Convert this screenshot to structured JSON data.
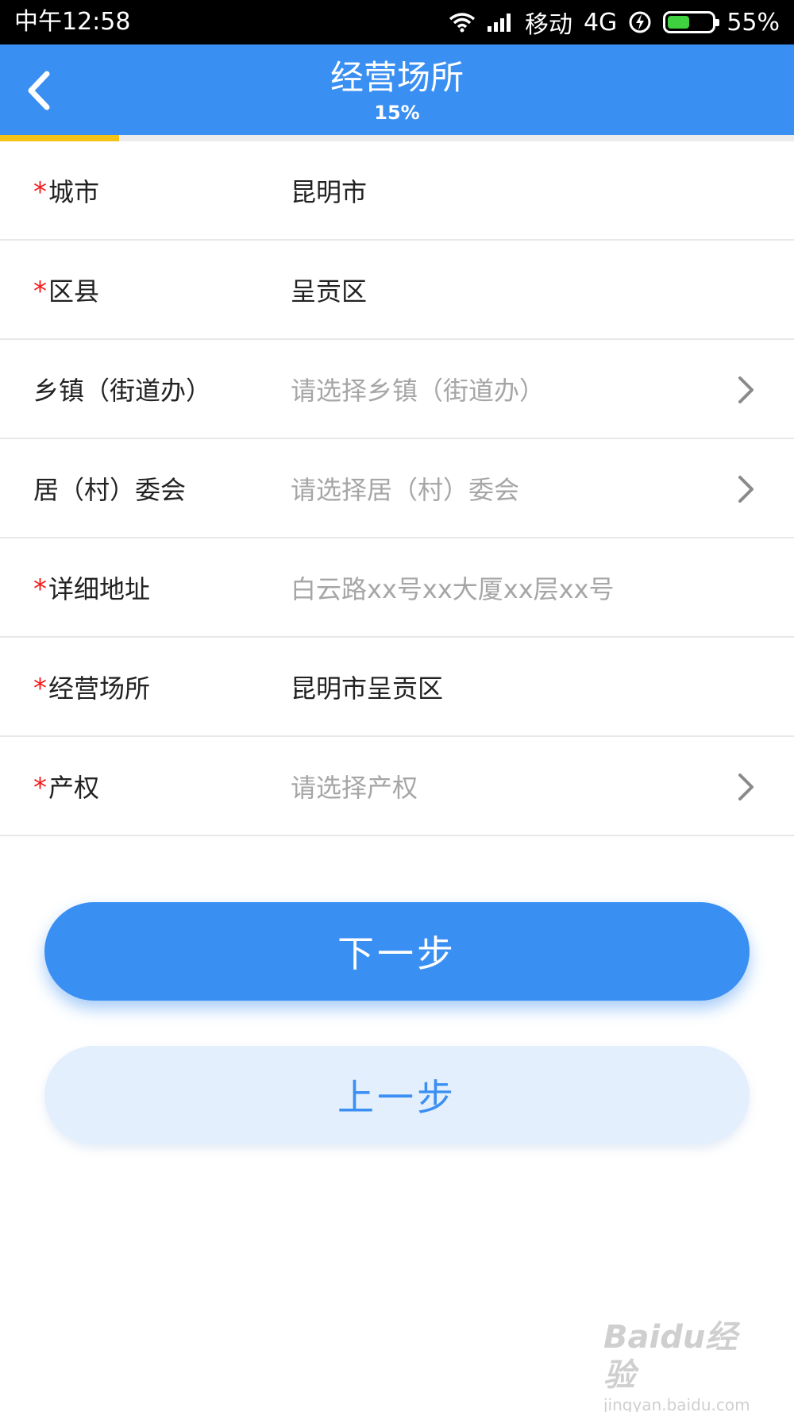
{
  "status_bar": {
    "time": "中午12:58",
    "carrier": "移动",
    "network": "4G",
    "battery_percent": "55%",
    "battery_level": 0.55,
    "battery_color": "#3fd13f"
  },
  "header": {
    "title": "经营场所",
    "progress_label": "15%",
    "progress_value": 0.15,
    "background_color": "#3a8ff2",
    "progress_color": "#f4c316"
  },
  "form": {
    "rows": [
      {
        "label": "城市",
        "required": "*",
        "value": "昆明市"
      },
      {
        "label": "区县",
        "required": "*",
        "value": "呈贡区"
      },
      {
        "label": "乡镇（街道办）",
        "placeholder": "请选择乡镇（街道办）"
      },
      {
        "label": "居（村）委会",
        "placeholder": "请选择居（村）委会"
      },
      {
        "label": "详细地址",
        "required": "*",
        "placeholder": "白云路xx号xx大厦xx层xx号"
      },
      {
        "label": "经营场所",
        "required": "*",
        "value": "昆明市呈贡区"
      },
      {
        "label": "产权",
        "required": "*",
        "placeholder": "请选择产权"
      }
    ]
  },
  "buttons": {
    "next": "下一步",
    "prev": "上一步"
  },
  "watermark": {
    "logo": "Baidu经验",
    "url": "jingyan.baidu.com"
  }
}
